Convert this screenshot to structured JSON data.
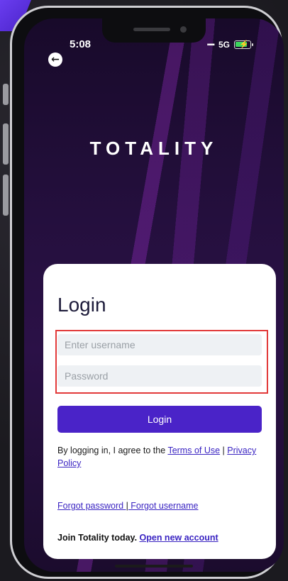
{
  "status_bar": {
    "time": "5:08",
    "network": "5G",
    "signal_glyph": "▪▪▪▪"
  },
  "icons": {
    "back": "back-arrow-icon",
    "battery": "battery-charging-icon",
    "signal": "signal-bars-icon"
  },
  "colors": {
    "accent": "#4a23c8",
    "link": "#3a24c2",
    "highlight": "#e23a3a"
  },
  "brand": {
    "logo_text": "TOTALITY"
  },
  "login": {
    "title": "Login",
    "username_placeholder": "Enter username",
    "username_value": "",
    "password_placeholder": "Password",
    "password_value": "",
    "button_label": "Login"
  },
  "legal": {
    "prefix": "By logging in, I agree to the ",
    "terms_label": "Terms of Use",
    "separator": " | ",
    "privacy_label": "Privacy Policy"
  },
  "forgot": {
    "password_label": "Forgot password ",
    "separator": "|",
    "username_label": " Forgot username"
  },
  "join": {
    "prefix": "Join Totality today. ",
    "link_label": "Open new account"
  }
}
